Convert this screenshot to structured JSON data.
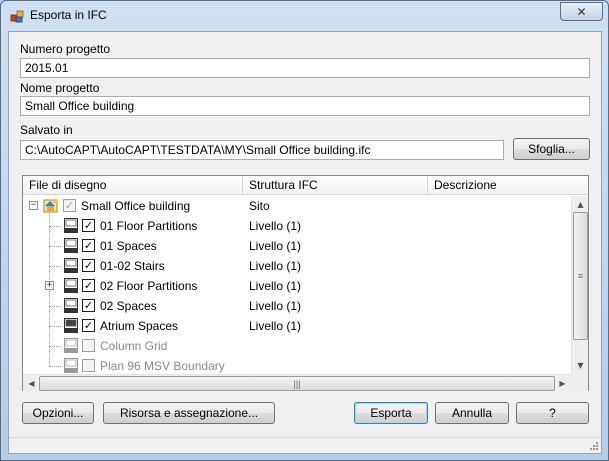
{
  "window": {
    "title": "Esporta in IFC",
    "close_symbol": "✕"
  },
  "fields": {
    "project_number_label": "Numero progetto",
    "project_number_value": "2015.01",
    "project_name_label": "Nome progetto",
    "project_name_value": "Small Office building",
    "saved_in_label": "Salvato in",
    "saved_in_value": "C:\\AutoCAPT\\AutoCAPT\\TESTDATA\\MY\\Small Office building.ifc",
    "browse_label": "Sfoglia..."
  },
  "tree": {
    "columns": [
      "File di disegno",
      "Struttura IFC",
      "Descrizione"
    ],
    "rows": [
      {
        "name": "Small Office building",
        "structure": "Sito",
        "checked": true,
        "enabled": true,
        "icon": "project-icon",
        "expander": "minus"
      },
      {
        "name": "01 Floor Partitions",
        "structure": "Livello (1)",
        "checked": true,
        "enabled": true,
        "icon": "dwg-icon",
        "expander": ""
      },
      {
        "name": "01 Spaces",
        "structure": "Livello (1)",
        "checked": true,
        "enabled": true,
        "icon": "dwg-icon",
        "expander": ""
      },
      {
        "name": "01-02 Stairs",
        "structure": "Livello (1)",
        "checked": true,
        "enabled": true,
        "icon": "dwg-icon",
        "expander": ""
      },
      {
        "name": "02 Floor Partitions",
        "structure": "Livello (1)",
        "checked": true,
        "enabled": true,
        "icon": "dwg-icon",
        "expander": "plus"
      },
      {
        "name": "02 Spaces",
        "structure": "Livello (1)",
        "checked": true,
        "enabled": true,
        "icon": "dwg-icon",
        "expander": ""
      },
      {
        "name": "Atrium Spaces",
        "structure": "Livello (1)",
        "checked": true,
        "enabled": true,
        "icon": "dwg-icon",
        "expander": ""
      },
      {
        "name": "Column Grid",
        "structure": "",
        "checked": false,
        "enabled": false,
        "icon": "dwg-icon",
        "expander": ""
      },
      {
        "name": "Plan 96 MSV Boundary",
        "structure": "",
        "checked": false,
        "enabled": false,
        "icon": "dwg-icon",
        "expander": ""
      }
    ]
  },
  "buttons": {
    "options": "Opzioni...",
    "resources": "Risorsa e assegnazione...",
    "export": "Esporta",
    "cancel": "Annulla",
    "help": "?"
  },
  "colors": {
    "window_frame": "#b9d1ea",
    "client_bg": "#f0f0f0",
    "disabled_text": "#8a8a8a"
  }
}
